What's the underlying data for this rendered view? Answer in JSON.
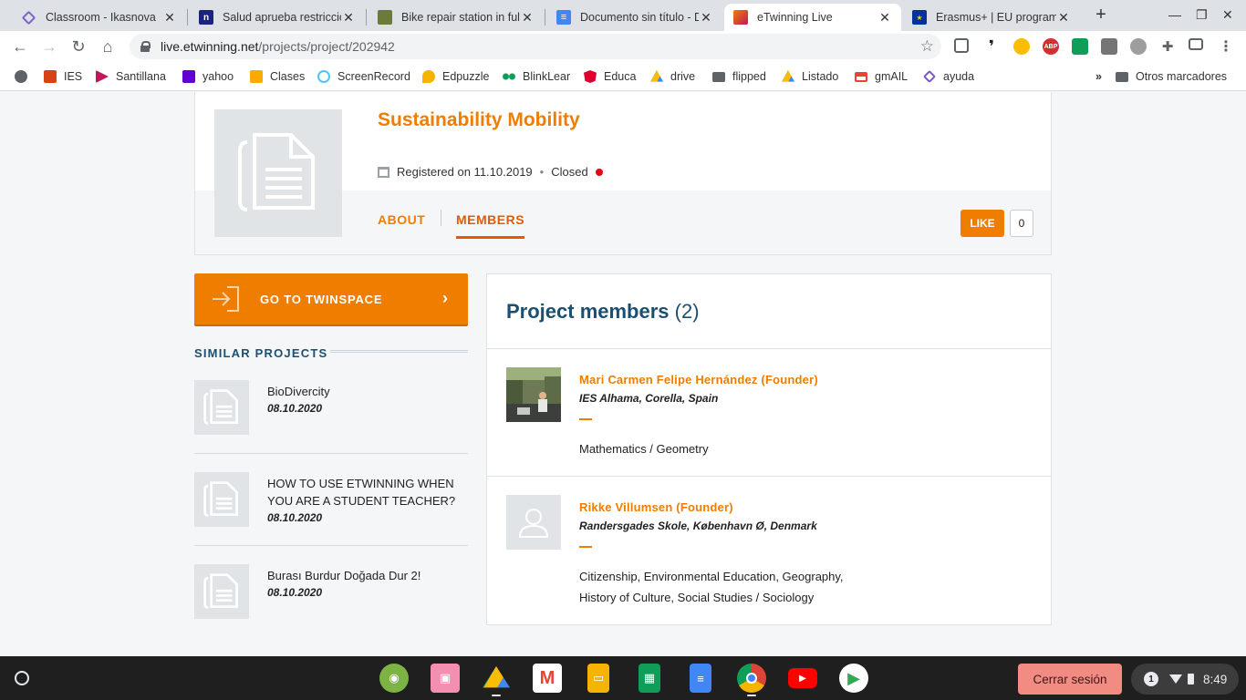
{
  "browser": {
    "tabs": [
      {
        "title": "Classroom - Ikasnova",
        "icon": "classroom-icon",
        "color": "#7b61c9"
      },
      {
        "title": "Salud aprueba restriccio",
        "icon": "news-icon",
        "color": "#1a237e"
      },
      {
        "title": "Bike repair station in full",
        "icon": "image-icon",
        "color": "#6d7b3a"
      },
      {
        "title": "Documento sin título - D",
        "icon": "docs-icon",
        "color": "#4285f4"
      },
      {
        "title": "eTwinning Live",
        "icon": "etwinning-icon",
        "color": "#ef7d00"
      },
      {
        "title": "Erasmus+ | EU programm",
        "icon": "eu-flag-icon",
        "color": "#003399"
      }
    ],
    "url_host": "live.etwinning.net",
    "url_path": "/projects/project/202942",
    "bookmarks": [
      {
        "label": "",
        "icon": "globe-icon",
        "color": "#5f6368"
      },
      {
        "label": "IES",
        "icon": "ies-icon",
        "color": "#d84315"
      },
      {
        "label": "Santillana",
        "icon": "play-icon",
        "color": "#c2185b"
      },
      {
        "label": "yahoo",
        "icon": "yahoo-icon",
        "color": "#6001d2"
      },
      {
        "label": "Clases",
        "icon": "classroom-icon",
        "color": "#f9ab00"
      },
      {
        "label": "ScreenRecord",
        "icon": "record-icon",
        "color": "#4fc3f7"
      },
      {
        "label": "Edpuzzle",
        "icon": "puzzle-icon",
        "color": "#f4b400"
      },
      {
        "label": "BlinkLear",
        "icon": "dots-icon",
        "color": "#0f9d58"
      },
      {
        "label": "Educa",
        "icon": "angular-icon",
        "color": "#dd0031"
      },
      {
        "label": "drive",
        "icon": "drive-icon",
        "color": "#34a853"
      },
      {
        "label": "flipped",
        "icon": "folder-icon",
        "color": "#5f6368"
      },
      {
        "label": "Listado",
        "icon": "drive-icon",
        "color": "#34a853"
      },
      {
        "label": "gmAIL",
        "icon": "gmail-icon",
        "color": "#ea4335"
      },
      {
        "label": "ayuda",
        "icon": "diamond-icon",
        "color": "#7e57c2"
      }
    ],
    "other_bookmarks": "Otros marcadores",
    "more_bookmarks": "»"
  },
  "project": {
    "title": "Sustainability Mobility",
    "registered": "Registered on 11.10.2019",
    "separator": "•",
    "status": "Closed",
    "status_color": "#e30613",
    "tab_about": "ABOUT",
    "tab_members": "MEMBERS",
    "like_label": "LIKE",
    "like_count": "0"
  },
  "sidebar": {
    "twinspace_label": "GO TO TWINSPACE",
    "twinspace_chevron": "›",
    "similar_title": "SIMILAR PROJECTS",
    "similar": [
      {
        "name": "BioDivercity",
        "date": "08.10.2020"
      },
      {
        "name": "HOW TO USE ETWINNING WHEN YOU ARE A STUDENT TEACHER?",
        "date": "08.10.2020"
      },
      {
        "name": "Burası Burdur Doğada Dur 2!",
        "date": "08.10.2020"
      }
    ]
  },
  "members": {
    "title": "Project members",
    "count": "(2)",
    "list": [
      {
        "name": "Mari Carmen Felipe Hernández (Founder)",
        "school": "IES Alhama, Corella, Spain",
        "subjects": "Mathematics / Geometry",
        "avatar": "photo"
      },
      {
        "name": "Rikke Villumsen (Founder)",
        "school": "Randersgades Skole, København Ø, Denmark",
        "subjects": "Citizenship, Environmental Education, Geography, History of Culture, Social Studies / Sociology",
        "avatar": "placeholder"
      }
    ]
  },
  "shelf": {
    "apps": [
      {
        "icon": "eye-app-icon",
        "color": "#7cb342"
      },
      {
        "icon": "screencast-app-icon",
        "color": "#f48fb1"
      },
      {
        "icon": "drive-app-icon",
        "color": "#34a853"
      },
      {
        "icon": "gmail-app-icon",
        "color": "#ea4335"
      },
      {
        "icon": "slides-app-icon",
        "color": "#f4b400"
      },
      {
        "icon": "sheets-app-icon",
        "color": "#0f9d58"
      },
      {
        "icon": "docs-app-icon",
        "color": "#4285f4"
      },
      {
        "icon": "chrome-app-icon",
        "color": "#db4437"
      },
      {
        "icon": "youtube-app-icon",
        "color": "#ff0000"
      },
      {
        "icon": "play-store-app-icon",
        "color": "#ffffff"
      }
    ],
    "signout_label": "Cerrar sesión",
    "notification_count": "1",
    "time": "8:49"
  },
  "colors": {
    "accent": "#ef7d00",
    "heading": "#1b4f72"
  }
}
